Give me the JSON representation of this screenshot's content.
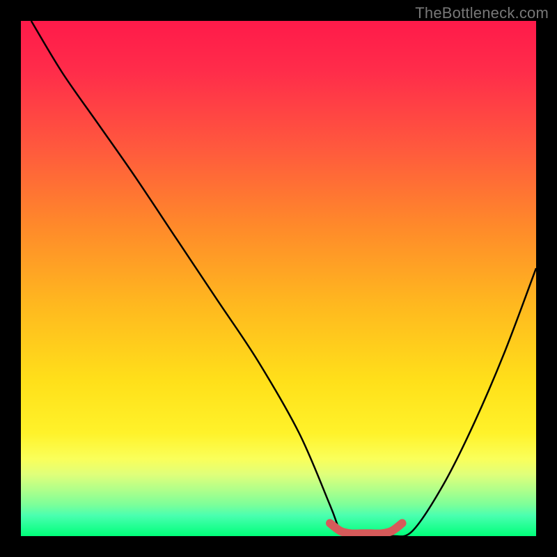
{
  "watermark": "TheBottleneck.com",
  "chart_data": {
    "type": "line",
    "title": "",
    "xlabel": "",
    "ylabel": "",
    "xlim": [
      0,
      100
    ],
    "ylim": [
      0,
      100
    ],
    "series": [
      {
        "name": "bottleneck-curve",
        "x": [
          2,
          8,
          15,
          22,
          30,
          38,
          46,
          54,
          60,
          62,
          64,
          68,
          72,
          76,
          82,
          88,
          94,
          100
        ],
        "values": [
          100,
          90,
          80,
          70,
          58,
          46,
          34,
          20,
          6,
          1,
          0,
          0,
          0,
          1,
          10,
          22,
          36,
          52
        ]
      },
      {
        "name": "optimal-marker",
        "x": [
          60,
          62,
          64,
          66,
          68,
          70,
          72,
          74
        ],
        "values": [
          2.5,
          1.0,
          0.5,
          0.5,
          0.5,
          0.5,
          1.0,
          2.5
        ]
      }
    ],
    "background_gradient": {
      "stops": [
        {
          "pos": 0,
          "color": "#ff1a4a"
        },
        {
          "pos": 50,
          "color": "#ffb81f"
        },
        {
          "pos": 80,
          "color": "#fff22a"
        },
        {
          "pos": 100,
          "color": "#00ff7a"
        }
      ]
    }
  }
}
